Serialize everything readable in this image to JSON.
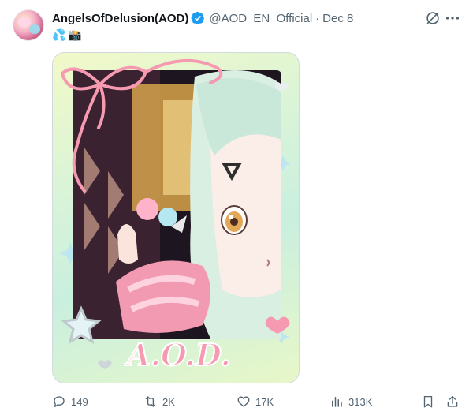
{
  "user": {
    "display_name": "AngelsOfDelusion(AOD)",
    "verified": true,
    "handle": "@AOD_EN_Official",
    "separator": "·",
    "date": "Dec 8",
    "avatar_icon": "avatar-image"
  },
  "tweet": {
    "emojis": [
      "💦",
      "📸"
    ]
  },
  "media": {
    "overlay_text": "A.O.D.",
    "icon": "media-image"
  },
  "actions": {
    "reply_count": "149",
    "retweet_count": "2K",
    "like_count": "17K",
    "views_count": "313K"
  },
  "colors": {
    "text_primary": "#0f1419",
    "text_secondary": "#536471",
    "verified_blue": "#1d9bf0",
    "pink_accent": "#f39ab3"
  }
}
